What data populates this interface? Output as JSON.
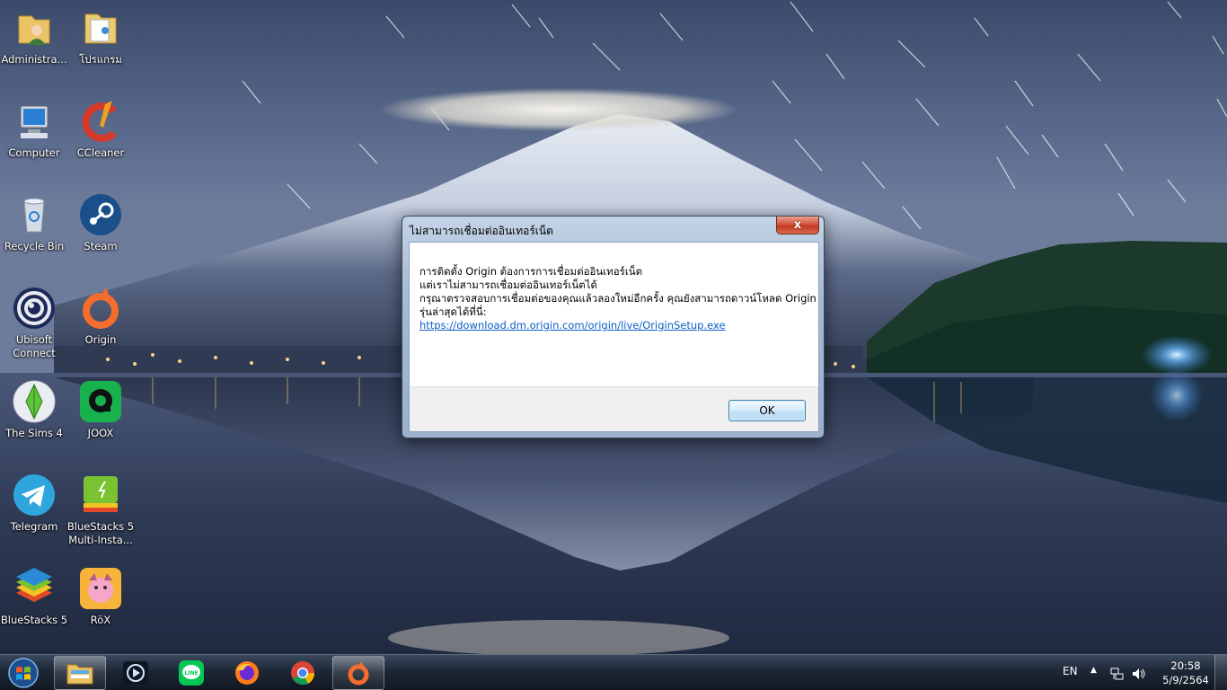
{
  "desktop": {
    "icons": [
      {
        "label": "Administra..."
      },
      {
        "label": "โปรแกรม"
      },
      {
        "label": "Computer"
      },
      {
        "label": "CCleaner"
      },
      {
        "label": "Recycle Bin"
      },
      {
        "label": "Steam"
      },
      {
        "label": "Ubisoft Connect"
      },
      {
        "label": "Origin"
      },
      {
        "label": "The Sims 4"
      },
      {
        "label": "JOOX"
      },
      {
        "label": "Telegram"
      },
      {
        "label": "BlueStacks 5 Multi-Insta..."
      },
      {
        "label": "BlueStacks 5"
      },
      {
        "label": "RöX"
      }
    ]
  },
  "dialog": {
    "title": "ไม่สามารถเชื่อมต่ออินเทอร์เน็ต",
    "close_label": "x",
    "lines": [
      "การติดตั้ง Origin ต้องการการเชื่อมต่ออินเทอร์เน็ต",
      "แต่เราไม่สามารถเชื่อมต่ออินเทอร์เน็ตได้",
      "กรุณาตรวจสอบการเชื่อมต่อของคุณแล้วลองใหม่อีกครั้ง คุณยังสามารถดาวน์โหลด Origin",
      "รุ่นล่าสุดได้ที่นี่:"
    ],
    "link": "https://download.dm.origin.com/origin/live/OriginSetup.exe",
    "ok_label": "OK"
  },
  "taskbar": {
    "items": [
      {
        "icon": "file-explorer-icon",
        "active": true
      },
      {
        "icon": "media-player-icon",
        "active": false
      },
      {
        "icon": "line-icon",
        "active": false
      },
      {
        "icon": "firefox-icon",
        "active": false
      },
      {
        "icon": "chrome-icon",
        "active": false
      },
      {
        "icon": "origin-icon",
        "active": true
      }
    ],
    "language": "EN",
    "time": "20:58",
    "date": "5/9/2564"
  },
  "colors": {
    "link": "#0b5fc6",
    "origin_orange": "#f56c2d",
    "steam_blue": "#1b4f8a",
    "close_red": "#c23a22"
  }
}
